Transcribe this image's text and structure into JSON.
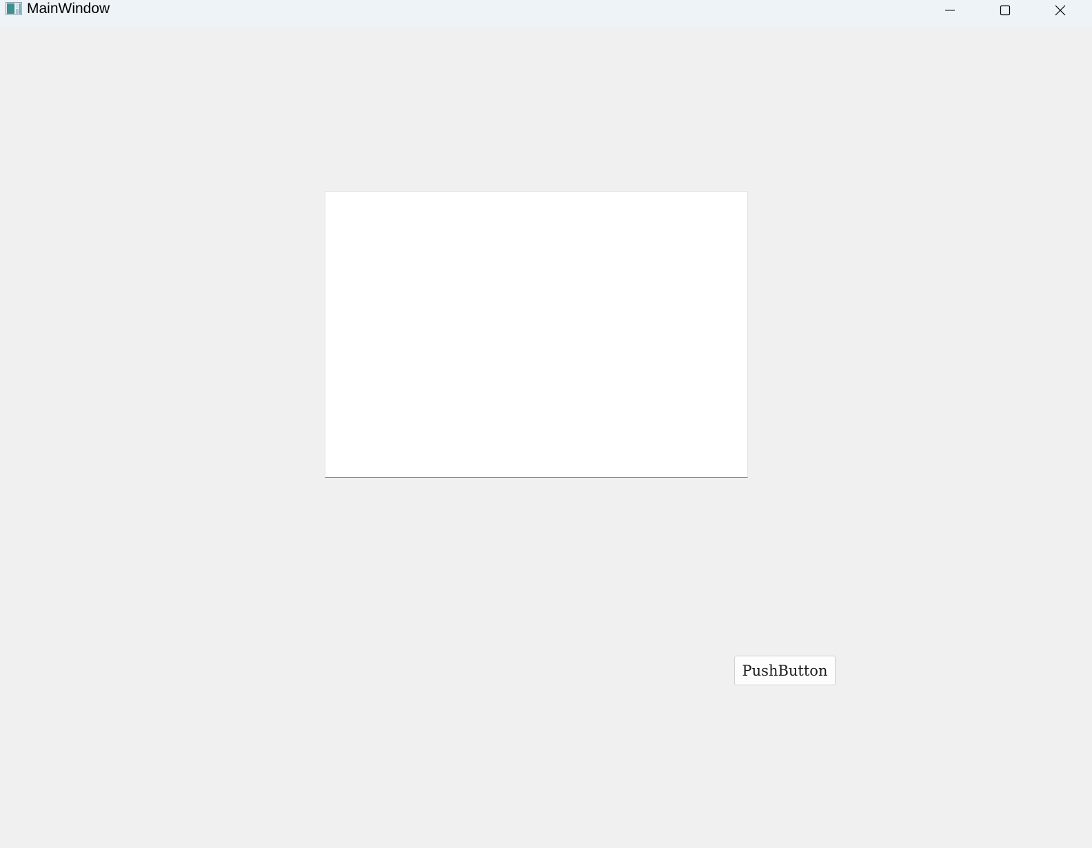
{
  "window": {
    "title": "MainWindow",
    "icon": "app-window-icon",
    "controls": {
      "minimize_icon": "minimize-icon",
      "maximize_icon": "maximize-icon",
      "close_icon": "close-icon"
    }
  },
  "main": {
    "push_button_label": "PushButton"
  },
  "colors": {
    "background": "#f0f0f0",
    "titlebar": "#eef3f7",
    "content_area": "#ffffff"
  }
}
